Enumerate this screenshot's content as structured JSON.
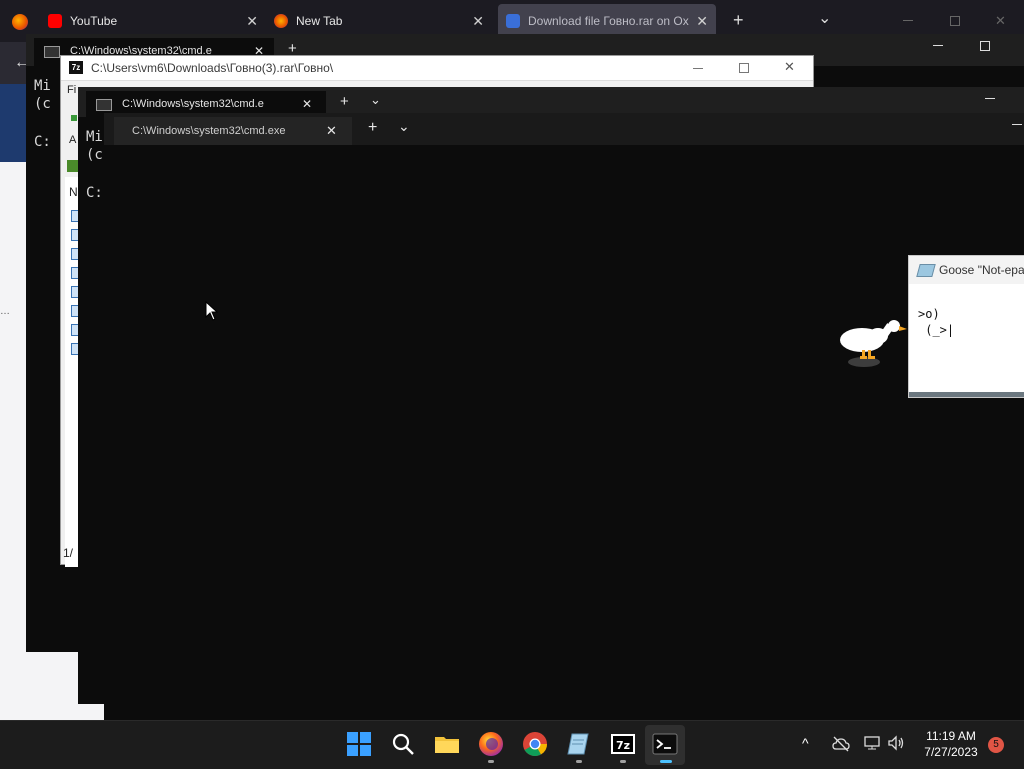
{
  "browser": {
    "tabs": [
      {
        "label": "YouTube",
        "icon": "youtube-icon"
      },
      {
        "label": "New Tab",
        "icon": "firefox-icon"
      },
      {
        "label": "Download file Говно.rar on Ox",
        "icon": "site-icon"
      }
    ],
    "new_tab": "+",
    "tab_list": "⌄",
    "back": "←"
  },
  "cmd_back": {
    "title": "C:\\Windows\\system32\\cmd.e",
    "line1": "Mi",
    "line2": "(c",
    "line3": "C:"
  },
  "zip": {
    "title": "C:\\Users\\vm6\\Downloads\\Говно(3).rar\\Говно\\",
    "menu_fragment": "Fi",
    "addr_fragment": "A",
    "col_fragment": "N",
    "status_fragment": "1/"
  },
  "cmd_mid": {
    "title": "C:\\Windows\\system32\\cmd.e",
    "line1": "Mi",
    "line2": "(c",
    "line3": "C:"
  },
  "cmd_front": {
    "title": "C:\\Windows\\system32\\cmd.exe",
    "new_tab": "+",
    "dropdown": "⌄"
  },
  "goose": {
    "title": "Goose \"Not-epa",
    "text": ">o)\n (_>|"
  },
  "taskbar": {
    "time": "11:19 AM",
    "date": "7/27/2023",
    "notifications": "5",
    "chevron": "^"
  },
  "colors": {
    "accent_blue": "#0a64c8",
    "terminal_bg": "#0c0c0c",
    "taskbar_bg": "#1c1c1c",
    "badge": "#e05545"
  }
}
